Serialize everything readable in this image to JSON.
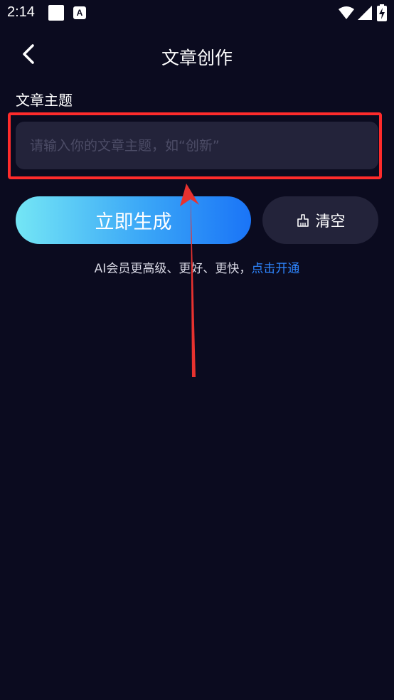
{
  "status_bar": {
    "time": "2:14",
    "notification_icon_letter": "A"
  },
  "header": {
    "title": "文章创作"
  },
  "form": {
    "section_label": "文章主题",
    "topic_input_placeholder": "请输入你的文章主题，如“创新”",
    "topic_input_value": ""
  },
  "actions": {
    "generate_label": "立即生成",
    "clear_label": "清空"
  },
  "promo": {
    "text": "AI会员更高级、更好、更快，",
    "link_label": "点击开通"
  },
  "colors": {
    "background": "#0b0b1f",
    "input_bg": "#23233a",
    "accent_link": "#2e86ff",
    "gradient_start": "#74e6f5",
    "gradient_end": "#1a74f7",
    "annotation_red": "#ff2b2b"
  },
  "icons": {
    "back": "chevron-left-icon",
    "clear": "broom-icon",
    "wifi": "wifi-icon",
    "signal": "signal-icon",
    "battery": "battery-charging-icon"
  }
}
